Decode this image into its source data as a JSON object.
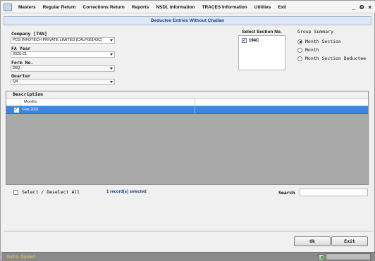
{
  "menu": {
    "items": [
      "Masters",
      "Regular Return",
      "Corrections Return",
      "Reports",
      "NSDL Information",
      "TRACES Information",
      "Utilities",
      "Exit"
    ],
    "minimize": "_",
    "restore": "Θ",
    "close": "×"
  },
  "header": {
    "title": "Deductee Entries Without Challan"
  },
  "form": {
    "company_label": "Company [TAN]",
    "company_value": "PDS INFOTECH PRIVATE LIMITED [CALP08143C]",
    "fa_year_label": "FA Year",
    "fa_year_value": "2020-21",
    "form_no_label": "Form No.",
    "form_no_value": "26Q",
    "quarter_label": "Quarter",
    "quarter_value": "Q4"
  },
  "section": {
    "label": "Select Section No.",
    "items": [
      {
        "label": "194C",
        "checked": true
      }
    ]
  },
  "group_summary": {
    "label": "Group Summary",
    "options": [
      {
        "label": "Month Section",
        "selected": true
      },
      {
        "label": "Month",
        "selected": false
      },
      {
        "label": "Month Section Deductee",
        "selected": false
      }
    ]
  },
  "grid": {
    "caption": "Description",
    "columns": [
      "Months"
    ],
    "rows": [
      {
        "month": "Feb 2021",
        "checked": true,
        "selected": true
      }
    ]
  },
  "footer": {
    "select_all_label": "Select / Deselect All",
    "records_text": "1 record(s) selected",
    "search_label": "Search",
    "search_value": ""
  },
  "buttons": {
    "ok": "Ok",
    "exit": "Exit"
  },
  "status": {
    "text": "Data Saved"
  },
  "icons": {
    "app": "app-icon",
    "check": "✓"
  }
}
